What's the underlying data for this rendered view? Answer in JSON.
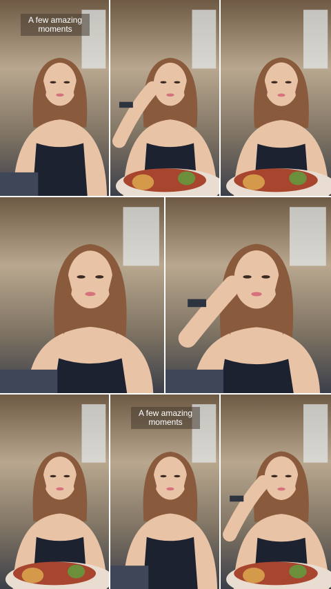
{
  "captions": {
    "top": [
      "A few amazing",
      "moments"
    ],
    "bottom": [
      "A few amazing",
      "moments"
    ]
  },
  "tiles": [
    {
      "name": "photo-1",
      "pose": "sitting-at-table"
    },
    {
      "name": "photo-2",
      "pose": "hand-on-face-with-food"
    },
    {
      "name": "photo-3",
      "pose": "leaning-with-food"
    },
    {
      "name": "photo-4",
      "pose": "close-up-talking"
    },
    {
      "name": "photo-5",
      "pose": "hand-on-face-close-up"
    },
    {
      "name": "photo-6",
      "pose": "leaning-with-food"
    },
    {
      "name": "photo-7",
      "pose": "sitting-at-table"
    },
    {
      "name": "photo-8",
      "pose": "hand-on-face-with-food"
    }
  ],
  "colors": {
    "canopy": "#b9a78f",
    "hair": "#8a5a3c",
    "skin": "#e9c3a6",
    "top": "#1c2230",
    "food": "#a8452f"
  }
}
